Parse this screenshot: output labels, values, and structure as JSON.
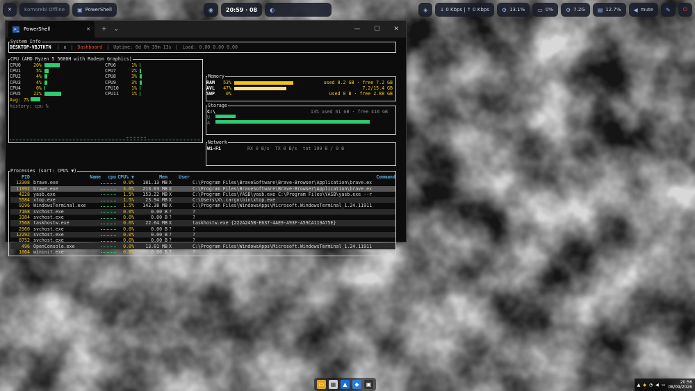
{
  "topbar": {
    "left_close": "✕",
    "komorebi": "Komorebi Offline",
    "powershell": "PowerShell",
    "workspace_icon": "◉",
    "time": "20:59 · 08",
    "network": "↓ 0 Kbps | ↑ 0 Kbps",
    "cpu": "13.1%",
    "gpu": "0%",
    "mem": "7.2G",
    "disk": "12.7%",
    "volume": "mute"
  },
  "window": {
    "tab_title": "PowerShell",
    "tab_close": "✕",
    "new_tab": "+",
    "dropdown": "⌄",
    "minimize": "—",
    "maximize": "☐",
    "close": "✕"
  },
  "sysinfo": {
    "label": "System Info",
    "host": "DESKTOP-VBJTKTN",
    "x": "x",
    "dashboard": "Dashboard",
    "uptime": "Uptime: 0d 0h 39m 13s",
    "load": "Load: 0.00 0.00 0.00"
  },
  "cpu": {
    "label": "CPU (AMD Ryzen 5 5600H with Radeon Graphics)",
    "left": [
      {
        "name": "CPU0",
        "pct": "20%",
        "v": 20
      },
      {
        "name": "CPU1",
        "pct": "5%",
        "v": 5
      },
      {
        "name": "CPU2",
        "pct": "4%",
        "v": 4
      },
      {
        "name": "CPU3",
        "pct": "4%",
        "v": 4
      },
      {
        "name": "CPU4",
        "pct": "0%",
        "v": 0
      },
      {
        "name": "CPU5",
        "pct": "22%",
        "v": 22
      }
    ],
    "right": [
      {
        "name": "CPU6",
        "pct": "1%",
        "v": 1
      },
      {
        "name": "CPU7",
        "pct": "2%",
        "v": 2
      },
      {
        "name": "CPU8",
        "pct": "3%",
        "v": 3
      },
      {
        "name": "CPU9",
        "pct": "3%",
        "v": 3
      },
      {
        "name": "CPU10",
        "pct": "1%",
        "v": 1
      },
      {
        "name": "CPU11",
        "pct": "1%",
        "v": 1
      }
    ],
    "avg": "Avg: 7%",
    "history": "history: cpu %"
  },
  "memory": {
    "label": "Memory",
    "rows": [
      {
        "name": "RAM",
        "pct": "53%",
        "v": 53,
        "color": "#f1c40f",
        "text": "used 8.2 GB · free 7.2 GB"
      },
      {
        "name": "AVL",
        "pct": "47%",
        "v": 47,
        "color": "#ffe082",
        "text": "7.2/15.4 GB"
      },
      {
        "name": "SWP",
        "pct": "0%",
        "v": 0,
        "color": "#2ecc71",
        "text": "used 0 B · free 2.88 GB"
      }
    ]
  },
  "storage": {
    "label": "Storage",
    "drive": "C:\\",
    "info": "13% used 61 GB · free 416 GB",
    "u": "U",
    "a": "A"
  },
  "network": {
    "label": "Network",
    "iface": "Wi-Fi",
    "rx": "RX 0 B/s",
    "tx": "TX 0 B/s",
    "tot": "tot 109 B / 0 B"
  },
  "processes": {
    "label": "Processes (sort: CPU% ▼)",
    "headers": {
      "pid": "PID",
      "name": "Name",
      "cpu": "cpu",
      "pct": "CPU% ▼",
      "mem": "Mem",
      "user": "User",
      "cmd": "Command"
    },
    "rows": [
      {
        "pid": "12308",
        "name": "brave.exe",
        "pct": "0.0%",
        "mem": "181.13 MB",
        "user": "X",
        "cmd": "C:\\Program Files\\BraveSoftware\\Brave-Browser\\Application\\brave.ex"
      },
      {
        "pid": "11992",
        "name": "brave.exe",
        "pct": "3.0%",
        "mem": "213.03 MB",
        "user": "X",
        "cmd": "C:\\Program Files\\BraveSoftware\\Brave-Browser\\Application\\brave.ex"
      },
      {
        "pid": "4228",
        "name": "yasb.exe",
        "pct": "1.5%",
        "mem": "153.22 MB",
        "user": "X",
        "cmd": "C:\\Program Files\\YASB\\yasb.exe C:\\Program Files\\YASB\\yasb.exe --r"
      },
      {
        "pid": "5584",
        "name": "xtop.exe",
        "pct": "1.5%",
        "mem": "23.94 MB",
        "user": "X",
        "cmd": "C:\\Users\\X\\.cargo\\bin\\xtop.exe"
      },
      {
        "pid": "9296",
        "name": "WindowsTerminal.exe",
        "pct": "1.5%",
        "mem": "142.38 MB",
        "user": "X",
        "cmd": "C:\\Program Files\\WindowsApps\\Microsoft.WindowsTerminal_1.24.11911"
      },
      {
        "pid": "7168",
        "name": "svchost.exe",
        "pct": "0.0%",
        "mem": "0.00 B",
        "user": "?",
        "cmd": "?"
      },
      {
        "pid": "3384",
        "name": "svchost.exe",
        "pct": "0.0%",
        "mem": "0.00 B",
        "user": "?",
        "cmd": "?"
      },
      {
        "pid": "7568",
        "name": "taskhostw.exe",
        "pct": "0.0%",
        "mem": "22.64 MB",
        "user": "X",
        "cmd": "taskhostw.exe {222A245B-E637-4AE9-A93F-A59CA119A75E}"
      },
      {
        "pid": "2960",
        "name": "svchost.exe",
        "pct": "0.0%",
        "mem": "0.00 B",
        "user": "?",
        "cmd": "?"
      },
      {
        "pid": "12292",
        "name": "svchost.exe",
        "pct": "0.0%",
        "mem": "0.00 B",
        "user": "?",
        "cmd": "?"
      },
      {
        "pid": "8752",
        "name": "svchost.exe",
        "pct": "0.0%",
        "mem": "0.00 B",
        "user": "?",
        "cmd": "?"
      },
      {
        "pid": "496",
        "name": "OpenConsole.exe",
        "pct": "0.0%",
        "mem": "13.01 MB",
        "user": "X",
        "cmd": "C:\\Program Files\\WindowsApps\\Microsoft.WindowsTerminal_1.24.11911"
      },
      {
        "pid": "1064",
        "name": "wininit.exe",
        "pct": "0.0%",
        "mem": "0.00 B",
        "user": "?",
        "cmd": "?"
      }
    ]
  },
  "tray": {
    "time": "20:56",
    "date": "08/09/2026"
  },
  "colors": {
    "accent_green": "#2ecc71",
    "accent_yellow": "#f1c40f",
    "header_blue": "#5dade2"
  }
}
